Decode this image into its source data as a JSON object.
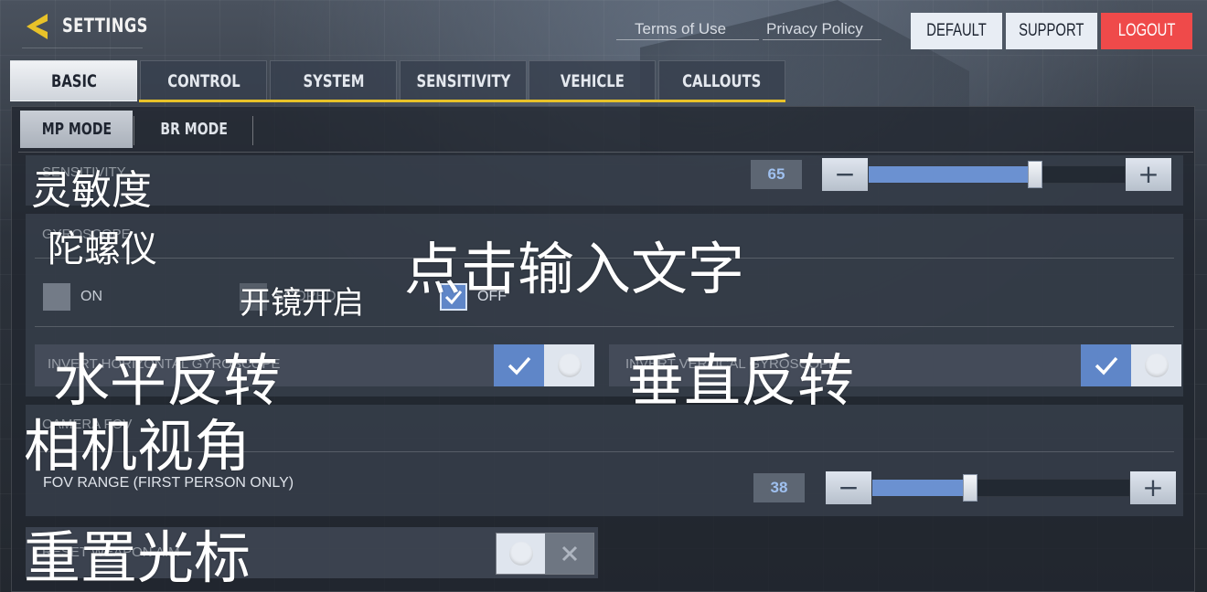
{
  "header": {
    "title": "SETTINGS",
    "links": {
      "terms": "Terms of Use",
      "privacy": "Privacy Policy"
    },
    "buttons": {
      "default": "DEFAULT",
      "support": "SUPPORT",
      "logout": "LOGOUT"
    }
  },
  "tabs": [
    "BASIC",
    "CONTROL",
    "SYSTEM",
    "SENSITIVITY",
    "VEHICLE",
    "CALLOUTS"
  ],
  "active_tab": "BASIC",
  "subtabs": [
    "MP MODE",
    "BR MODE"
  ],
  "active_subtab": "MP MODE",
  "sensitivity": {
    "label": "SENSITIVITY",
    "value": "65",
    "fill_percent": 65
  },
  "gyroscope": {
    "section_label": "GYROSCOPE",
    "options": [
      "ON",
      "SCOPED",
      "OFF"
    ],
    "checked_option": "OFF",
    "invert_horizontal": {
      "label": "INVERT HORIZONTAL GYROSCOPE",
      "on": true
    },
    "invert_vertical": {
      "label": "INVERT VERTICAL GYROSCOPE",
      "on": true
    }
  },
  "camera_fov": {
    "section_label": "CAMERA FOV",
    "range_label": "FOV RANGE (FIRST PERSON ONLY)",
    "value": "38",
    "fill_percent": 38
  },
  "reset_weapon_aim": {
    "label": "RESET WEAPON AIM",
    "on": false
  },
  "overlay": {
    "sensitivity": "灵敏度",
    "gyroscope": "陀螺仪",
    "tap_input": "点击输入文字",
    "scope_on": "开镜开启",
    "invert_horizontal": "水平反转",
    "invert_vertical": "垂直反转",
    "camera_fov": "相机视角",
    "reset_aim": "重置光标"
  },
  "colors": {
    "accent_blue": "#6b91d1",
    "tab_underline": "#e8c229",
    "logout_red": "#ef4a4a",
    "back_arrow_yellow": "#e8c229"
  },
  "icons": [
    "back-arrow-icon",
    "check-icon",
    "close-icon",
    "minus-icon",
    "plus-icon"
  ]
}
